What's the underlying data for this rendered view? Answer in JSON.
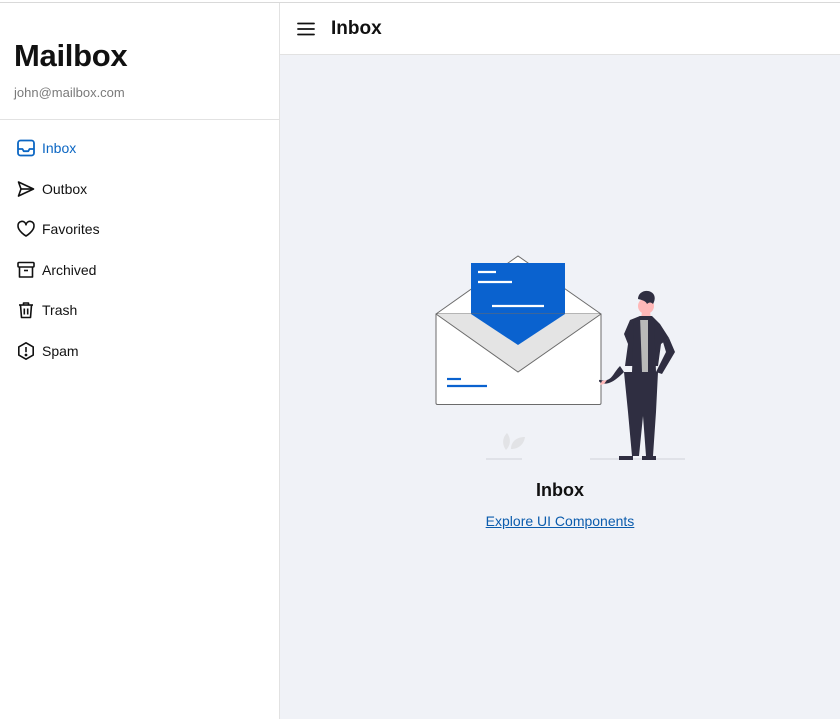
{
  "app": {
    "title": "Mailbox",
    "email": "john@mailbox.com"
  },
  "nav": [
    {
      "label": "Inbox",
      "icon": "inbox-icon",
      "active": true
    },
    {
      "label": "Outbox",
      "icon": "send-icon",
      "active": false
    },
    {
      "label": "Favorites",
      "icon": "heart-icon",
      "active": false
    },
    {
      "label": "Archived",
      "icon": "archive-icon",
      "active": false
    },
    {
      "label": "Trash",
      "icon": "trash-icon",
      "active": false
    },
    {
      "label": "Spam",
      "icon": "spam-icon",
      "active": false
    }
  ],
  "topbar": {
    "menu_icon": "hamburger-menu-icon",
    "title": "Inbox"
  },
  "empty_state": {
    "title": "Inbox",
    "link_label": "Explore UI Components"
  },
  "colors": {
    "accent": "#0b66c3",
    "main_bg": "#f0f2f7",
    "envelope_blue": "#0a62cf"
  }
}
